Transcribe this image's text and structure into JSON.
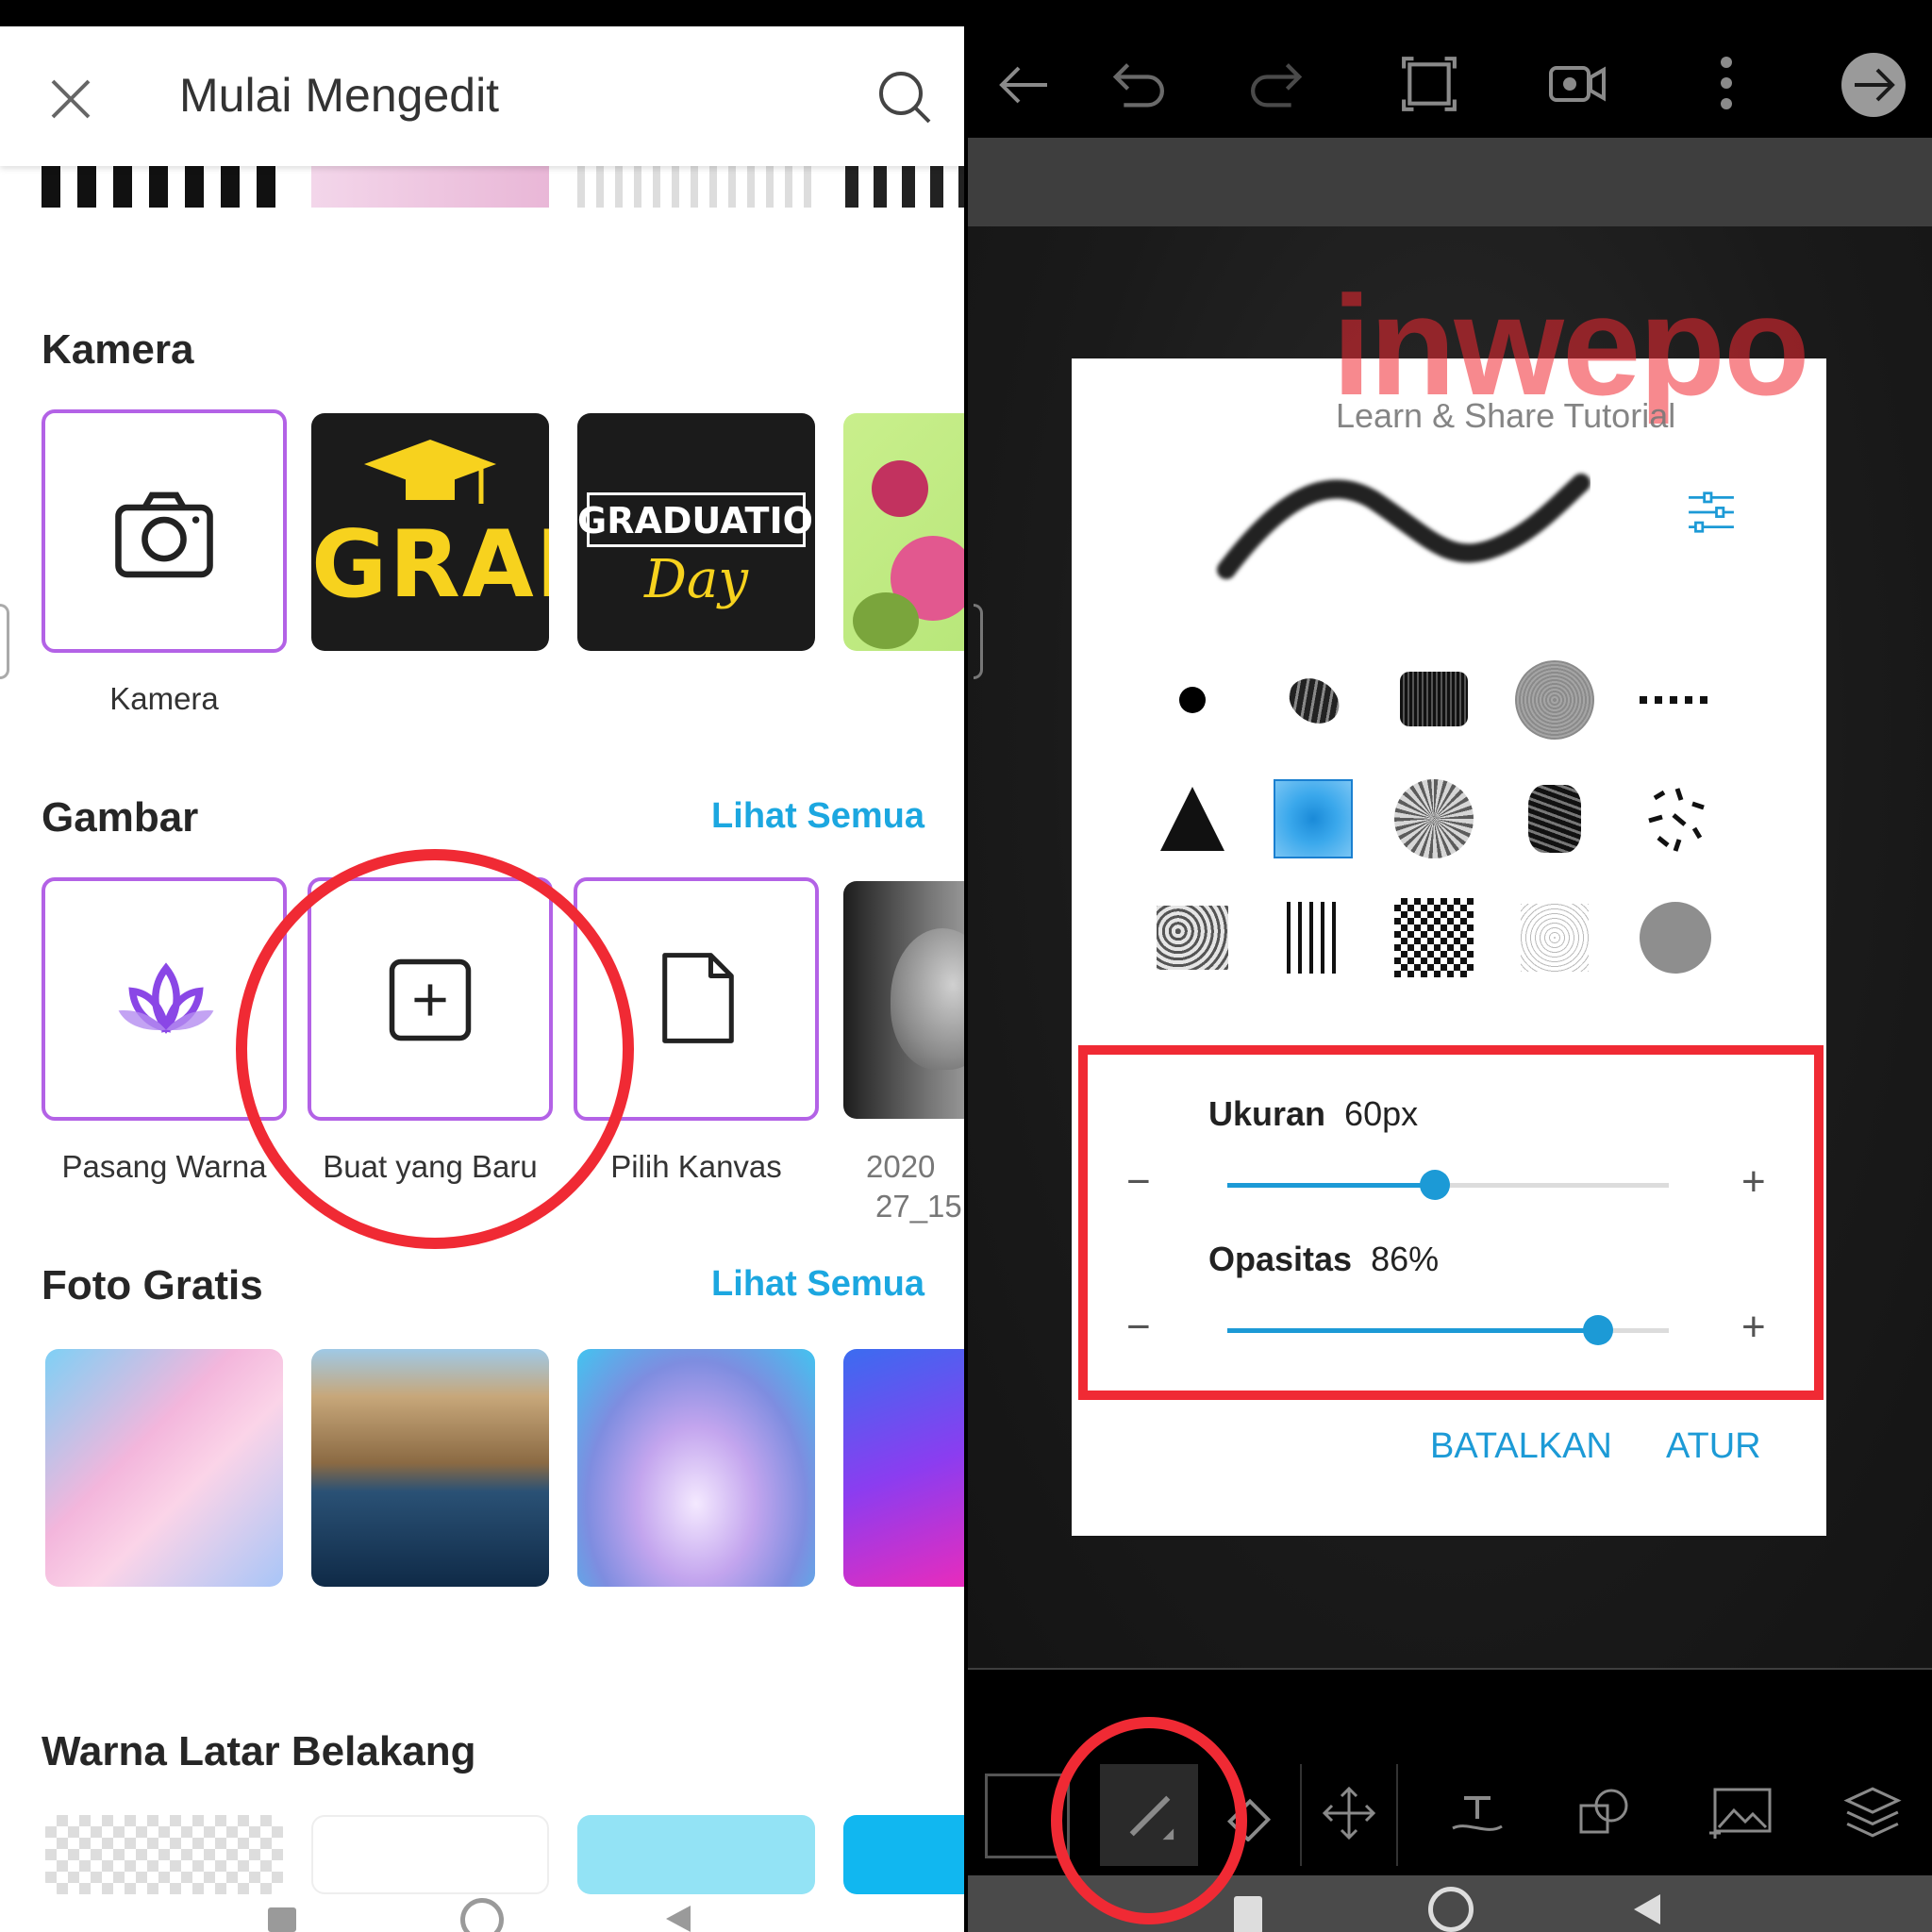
{
  "left": {
    "header": {
      "title": "Mulai Mengedit"
    },
    "kamera": {
      "title": "Kamera",
      "camera_label": "Kamera"
    },
    "gambar": {
      "title": "Gambar",
      "see_all": "Lihat Semua",
      "items": [
        "Pasang Warna",
        "Buat yang Baru",
        "Pilih Kanvas",
        "2020",
        "27_15"
      ]
    },
    "foto": {
      "title": "Foto Gratis",
      "see_all": "Lihat Semua"
    },
    "warna": {
      "title": "Warna Latar Belakang"
    },
    "thumbs": {
      "grad": "GRAD",
      "graduation": "GRADUATION",
      "day": "Day"
    }
  },
  "right": {
    "watermark": {
      "brand": "inwepo",
      "tagline": "Learn & Share Tutorial"
    },
    "size": {
      "label": "Ukuran",
      "value": "60px",
      "fraction": 0.47
    },
    "opacity": {
      "label": "Opasitas",
      "value": "86%",
      "fraction": 0.84
    },
    "minus": "−",
    "plus": "+",
    "cancel": "BATALKAN",
    "apply": "ATUR",
    "selected_brush": "soft-square",
    "accent": "#1c9ad6",
    "highlight": "#f02a34"
  }
}
